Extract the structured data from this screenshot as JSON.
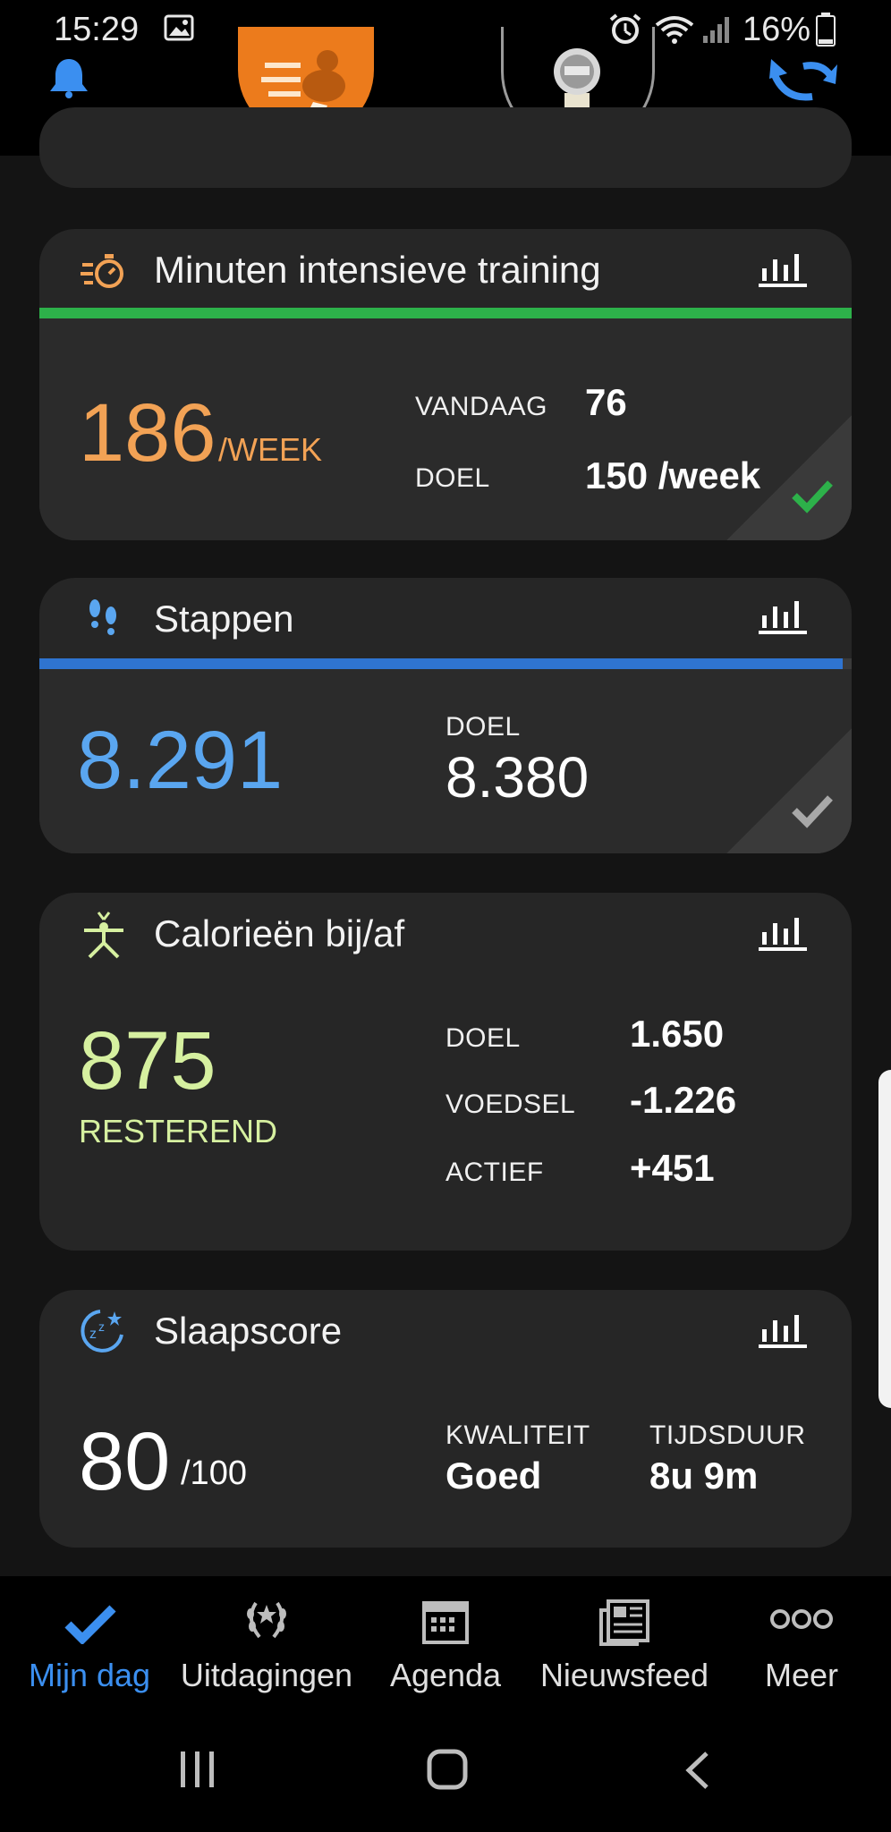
{
  "status_bar": {
    "time": "15:29",
    "battery": "16%"
  },
  "cards": {
    "intensive": {
      "title": "Minuten intensieve training",
      "big_value": "186",
      "unit": "/WEEK",
      "today_label": "VANDAAG",
      "today_value": "76",
      "goal_label": "DOEL",
      "goal_value": "150 /week",
      "accent_color": "#2db14a",
      "big_color": "#f2a255"
    },
    "steps": {
      "title": "Stappen",
      "big_value": "8.291",
      "goal_label": "DOEL",
      "goal_value": "8.380",
      "accent_color": "#2f74d0",
      "big_color": "#5aa6f0",
      "progress": 0.989
    },
    "calories": {
      "title": "Calorieën bij/af",
      "big_value": "875",
      "sub_label": "RESTEREND",
      "rows": [
        {
          "label": "DOEL",
          "value": "1.650"
        },
        {
          "label": "VOEDSEL",
          "value": "-1.226"
        },
        {
          "label": "ACTIEF",
          "value": "+451"
        }
      ],
      "big_color": "#d6f0a0"
    },
    "sleep": {
      "title": "Slaapscore",
      "big_value": "80",
      "unit": "/100",
      "quality_label": "KWALITEIT",
      "quality_value": "Goed",
      "duration_label": "TIJDSDUUR",
      "duration_value": "8u 9m"
    }
  },
  "bottom_nav": {
    "items": [
      {
        "label": "Mijn dag",
        "icon": "check-icon",
        "active": true
      },
      {
        "label": "Uitdagingen",
        "icon": "laurel-icon",
        "active": false
      },
      {
        "label": "Agenda",
        "icon": "calendar-icon",
        "active": false
      },
      {
        "label": "Nieuwsfeed",
        "icon": "newsfeed-icon",
        "active": false
      },
      {
        "label": "Meer",
        "icon": "more-icon",
        "active": false
      }
    ],
    "active_color": "#3b8ff0"
  }
}
